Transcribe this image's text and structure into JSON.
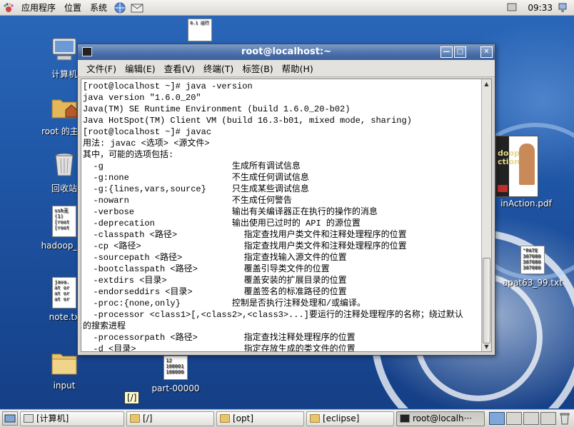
{
  "top_panel": {
    "menus": [
      "应用程序",
      "位置",
      "系统"
    ],
    "clock": "09:33"
  },
  "desktop_icons": [
    {
      "label": "计算机",
      "icon": "computer-icon"
    },
    {
      "label": "root 的主文",
      "icon": "home-folder-icon"
    },
    {
      "label": "回收站",
      "icon": "trash-icon"
    },
    {
      "label": "hadoop_ec",
      "icon": "text-file-icon",
      "preview": [
        "ssh无",
        "(1)",
        "[root",
        "[root"
      ]
    },
    {
      "label": "note.tx",
      "icon": "text-file-icon",
      "preview": [
        "java.",
        "at or",
        "at or",
        "at or"
      ]
    },
    {
      "label": "input",
      "icon": "folder-icon"
    },
    {
      "label": "part-00000",
      "icon": "text-file-icon",
      "preview": [
        "12",
        "100001",
        "100000"
      ]
    },
    {
      "label": "inAction.pdf",
      "icon": "pdf-icon",
      "preview": [
        "doop",
        "ction"
      ]
    },
    {
      "label": "apat63_99.txt",
      "icon": "text-file-icon",
      "preview": [
        "\"PATE",
        "307080",
        "307080",
        "307080"
      ]
    },
    {
      "label": "",
      "icon": "text-file-icon",
      "preview": [
        "0.1 运行"
      ]
    }
  ],
  "desktop_tooltip": "[/]",
  "terminal": {
    "title": "root@localhost:~",
    "menu": [
      "文件(F)",
      "编辑(E)",
      "查看(V)",
      "终端(T)",
      "标签(B)",
      "帮助(H)"
    ],
    "lines": [
      "[root@localhost ~]# java -version",
      "java version \"1.6.0_20\"",
      "Java(TM) SE Runtime Environment (build 1.6.0_20-b02)",
      "Java HotSpot(TM) Client VM (build 16.3-b01, mixed mode, sharing)",
      "[root@localhost ~]# javac",
      "用法: javac <选项> <源文件>",
      "其中，可能的选项包括:",
      "  -g                         生成所有调试信息",
      "  -g:none                    不生成任何调试信息",
      "  -g:{lines,vars,source}     只生成某些调试信息",
      "  -nowarn                    不生成任何警告",
      "  -verbose                   输出有关编译器正在执行的操作的消息",
      "  -deprecation               输出使用已过时的 API 的源位置",
      "  -classpath <路径>             指定查找用户类文件和注释处理程序的位置",
      "  -cp <路径>                    指定查找用户类文件和注释处理程序的位置",
      "  -sourcepath <路径>            指定查找输入源文件的位置",
      "  -bootclasspath <路径>         覆盖引导类文件的位置",
      "  -extdirs <目录>               覆盖安装的扩展目录的位置",
      "  -endorseddirs <目录>          覆盖签名的标准路径的位置",
      "  -proc:{none,only}          控制是否执行注释处理和/或编译。",
      "  -processor <class1>[,<class2>,<class3>...]要运行的注释处理程序的名称；绕过默认",
      "的搜索进程",
      "  -processorpath <路径>         指定查找注释处理程序的位置",
      "  -d <目录>                     指定存放生成的类文件的位置"
    ]
  },
  "taskbar": {
    "tasks": [
      {
        "label": "[计算机]",
        "icon": "computer-icon",
        "active": false
      },
      {
        "label": "[/]",
        "icon": "folder-icon",
        "active": false
      },
      {
        "label": "[opt]",
        "icon": "folder-icon",
        "active": false
      },
      {
        "label": "[eclipse]",
        "icon": "folder-icon",
        "active": false
      },
      {
        "label": "root@localh···",
        "icon": "terminal-icon",
        "active": true
      }
    ]
  }
}
